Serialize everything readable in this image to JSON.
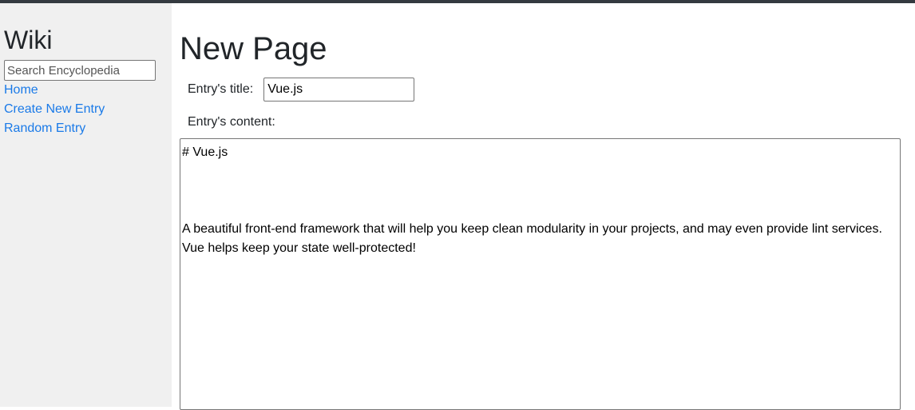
{
  "sidebar": {
    "title": "Wiki",
    "search": {
      "placeholder": "Search Encyclopedia",
      "value": ""
    },
    "links": [
      {
        "label": "Home"
      },
      {
        "label": "Create New Entry"
      },
      {
        "label": "Random Entry"
      }
    ]
  },
  "main": {
    "page_title": "New Page",
    "title_field": {
      "label": "Entry's title:",
      "value": "Vue.js"
    },
    "content_field": {
      "label": "Entry's content:",
      "value": "# Vue.js\n\n\n\nA beautiful front-end framework that will help you keep clean modularity in your projects, and may even provide lint services.\nVue helps keep your state well-protected!"
    }
  },
  "colors": {
    "topbar": "#343a40",
    "sidebar_bg": "#f0f0f0",
    "link": "#1a7ae8"
  }
}
